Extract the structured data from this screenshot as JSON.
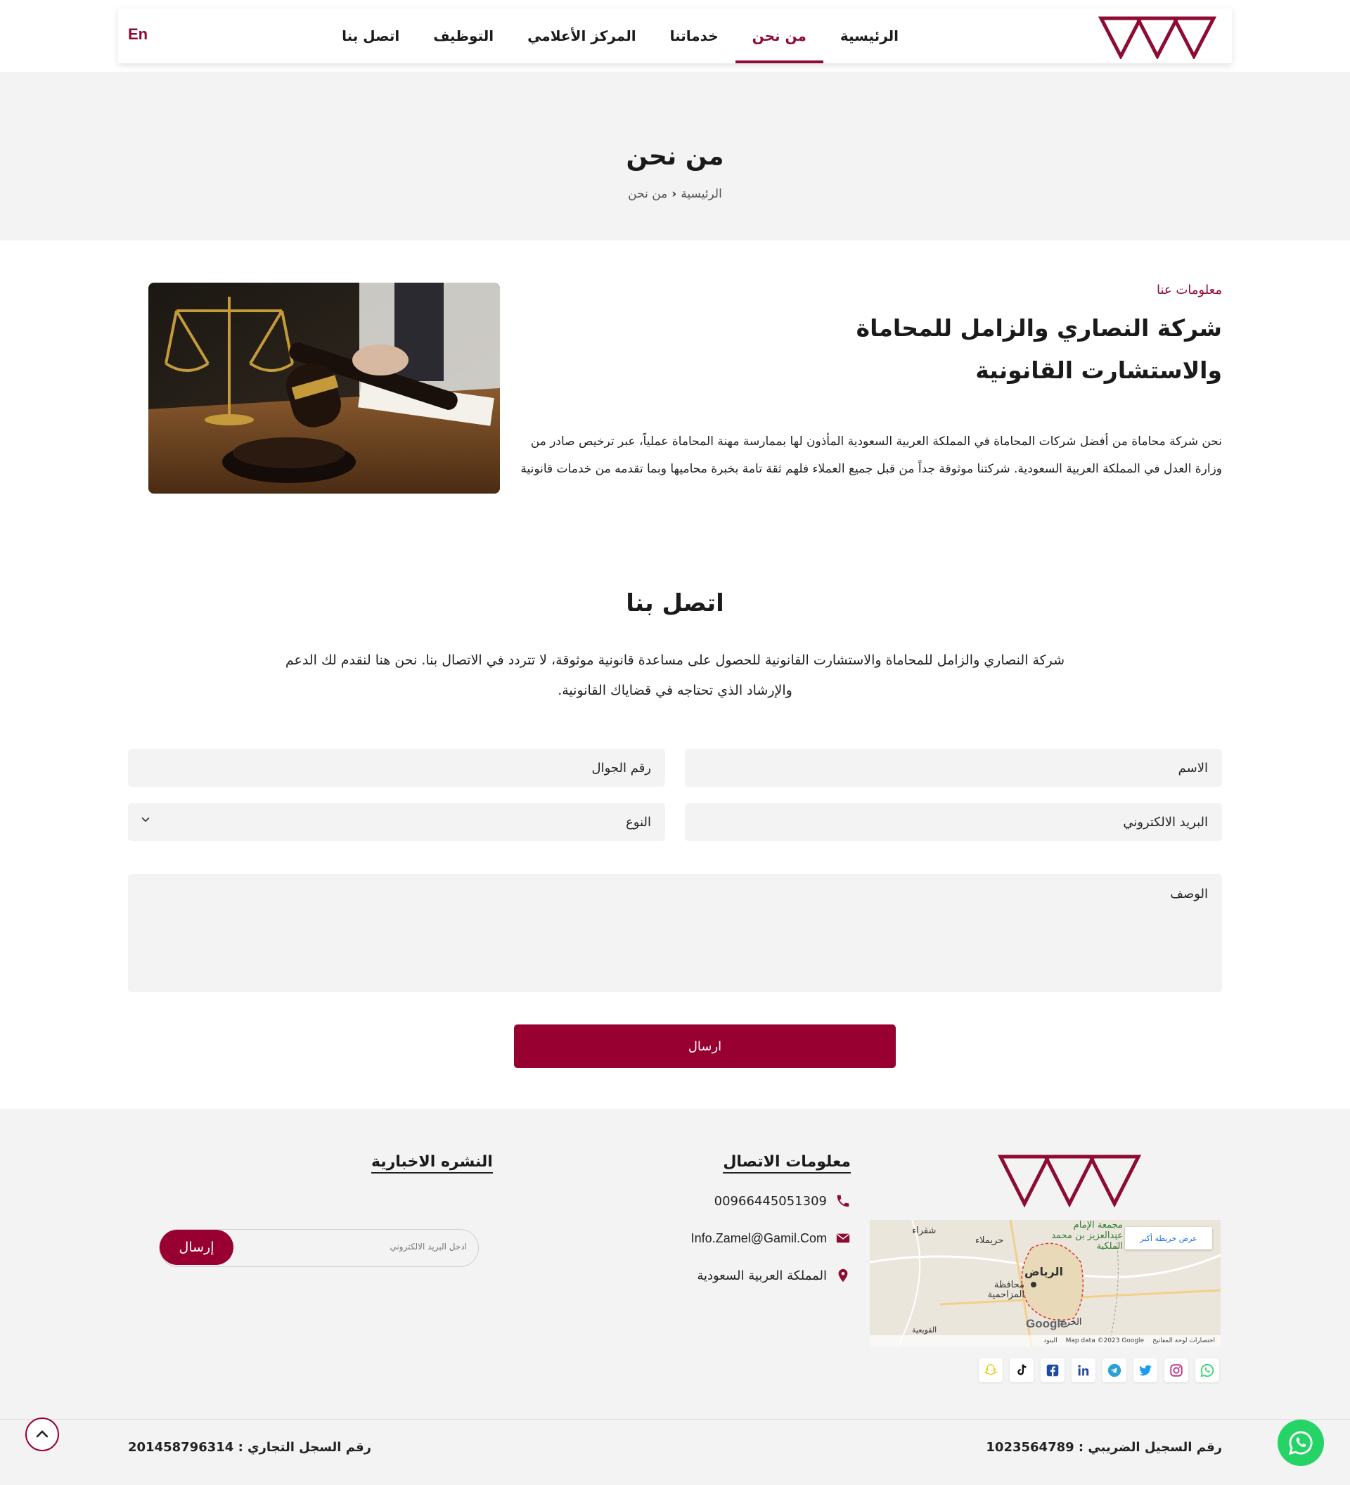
{
  "colors": {
    "brand": "#8e0b33",
    "button": "#980031",
    "whatsapp": "#25d366"
  },
  "header": {
    "logo": "logo",
    "lang": "En",
    "menu": [
      {
        "label": "الرئيسية"
      },
      {
        "label": "من نحن",
        "active": true
      },
      {
        "label": "خدماتنا"
      },
      {
        "label": "المركز الأعلامي"
      },
      {
        "label": "التوظيف"
      },
      {
        "label": "اتصل بنا"
      }
    ]
  },
  "banner": {
    "title": "من نحن",
    "breadcrumb": {
      "home": "الرئيسية",
      "current": "من نحن"
    }
  },
  "about": {
    "kicker": "معلومات عنا",
    "title": "شركة النصاري والزامل للمحاماة والاستشارت القانونية",
    "paragraph": "نحن شركة محاماة من أفضل شركات المحاماة في المملكة العربية السعودية المأذون لها بممارسة مهنة المحاماة عملياً، عبر ترخيص صادر من وزارة العدل في المملكة العربية السعودية. شركتنا موثوقة جداً من قبل جميع العملاء فلهم ثقة تامة بخبرة محاميها وبما تقدمه من خدمات قانونية",
    "image": "gavel-and-scales-photo"
  },
  "contact": {
    "title": "اتصل بنا",
    "description": "شركة النصاري والزامل للمحاماة والاستشارت القانونية للحصول على مساعدة قانونية موثوقة، لا تتردد في الاتصال بنا. نحن هنا لنقدم لك الدعم والإرشاد الذي تحتاجه في قضاياك القانونية.",
    "fields": {
      "name": "الاسم",
      "phone": "رقم الجوال",
      "email": "البريد الالكتروني",
      "type": "النوع",
      "description": "الوصف"
    },
    "submit": "ارسال"
  },
  "footer": {
    "contact_title": "معلومات الاتصال",
    "phone": "00966445051309",
    "email": "Info.Zamel@Gamil.Com",
    "location": "المملكة العربية السعودية",
    "newsletter_title": "النشره الاخبارية",
    "newsletter_placeholder": "ادخل البريد الالكتروني",
    "newsletter_button": "إرسال",
    "map": {
      "view_larger": "عرض خريطة أكبر",
      "city": "الرياض",
      "labels": [
        "شقراء",
        "حريملاء",
        "محافظة المزاحمية",
        "الخرج",
        "القويعية",
        "مجمعة الإمام عبدالعزيز بن محمد الملكية"
      ],
      "attribution": "Map data ©2023 Google",
      "shortcuts": "اختصارات لوحة المفاتيح",
      "terms": "البنود",
      "google": "Google"
    },
    "socials": [
      "snapchat-icon",
      "tiktok-icon",
      "facebook-icon",
      "linkedin-icon",
      "telegram-icon",
      "twitter-icon",
      "instagram-icon",
      "whatsapp-icon"
    ],
    "tax_number": "رقم السجيل الضريبي : 1023564789",
    "commercial_register": "رقم السجل التجاري : 201458796314"
  }
}
